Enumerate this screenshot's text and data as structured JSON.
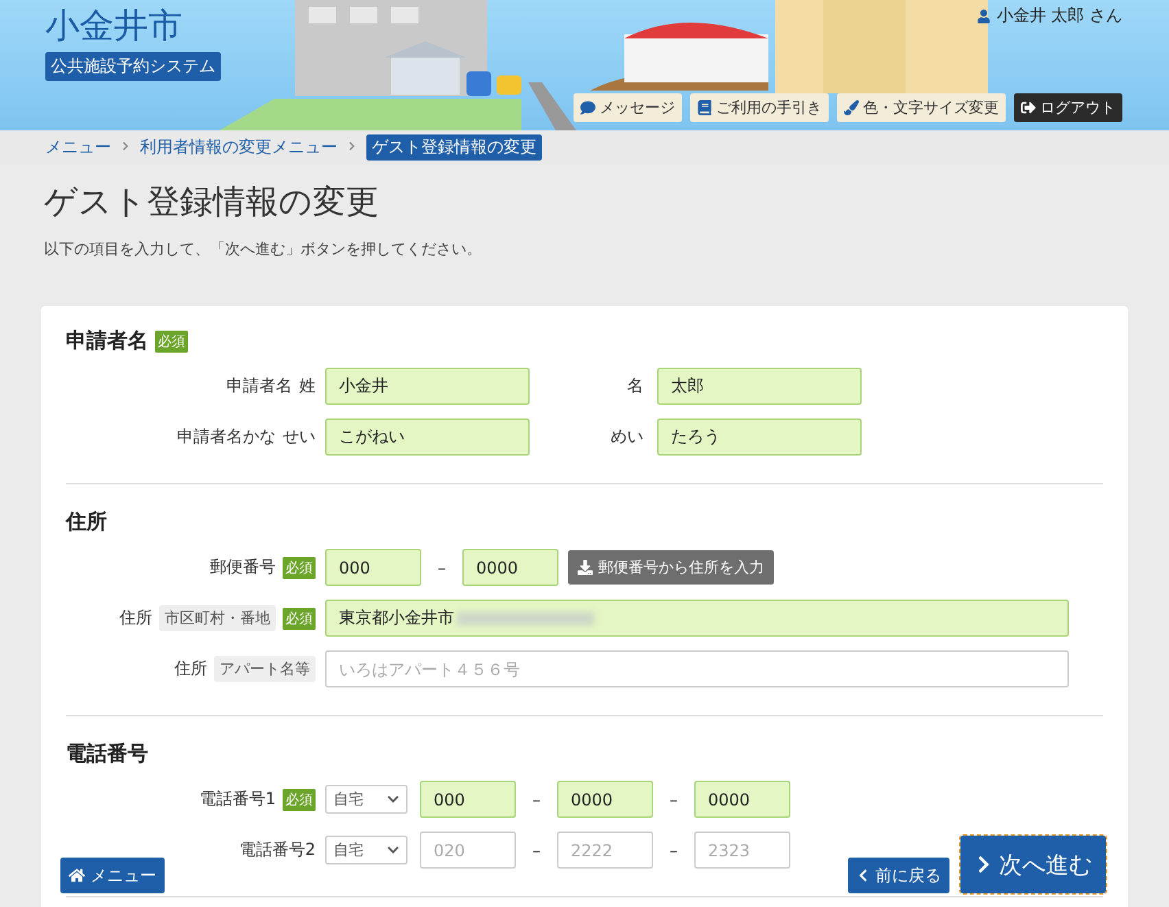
{
  "header": {
    "city": "小金井市",
    "system": "公共施設予約システム",
    "user": "小金井 太郎 さん",
    "actions": [
      {
        "label": "メッセージ",
        "kind": "message"
      },
      {
        "label": "ご利用の手引き",
        "kind": "guide"
      },
      {
        "label": "色・文字サイズ変更",
        "kind": "color"
      },
      {
        "label": "ログアウト",
        "kind": "logout"
      }
    ]
  },
  "breadcrumb": [
    {
      "label": "メニュー",
      "current": false
    },
    {
      "label": "利用者情報の変更メニュー",
      "current": false
    },
    {
      "label": "ゲスト登録情報の変更",
      "current": true
    }
  ],
  "title": "ゲスト登録情報の変更",
  "description": "以下の項目を入力して、「次へ進む」ボタンを押してください。",
  "sections": [
    {
      "heading": "申請者名",
      "badge": "必須",
      "rows": [
        {
          "kind": "pair",
          "label": "申請者名",
          "sublabel": "姓",
          "value": "小金井",
          "label2": "名",
          "value2": "太郎"
        },
        {
          "kind": "pair",
          "label": "申請者名かな",
          "sublabel": "せい",
          "value": "こがねい",
          "label2": "めい",
          "value2": "たろう"
        }
      ]
    },
    {
      "heading": "住所",
      "rows": [
        {
          "kind": "postal",
          "label": "郵便番号",
          "badge": "必須",
          "parts": [
            "000",
            "0000"
          ],
          "separator": "–",
          "button": "郵便番号から住所を入力"
        },
        {
          "kind": "text",
          "label": "住所",
          "tag": "市区町村・番地",
          "badge": "必須",
          "value": "東京都小金井市",
          "blurred": true
        },
        {
          "kind": "text",
          "label": "住所",
          "tag": "アパート名等",
          "placeholder": "いろはアパート４５６号"
        }
      ]
    },
    {
      "heading": "電話番号",
      "rows": [
        {
          "kind": "phone",
          "label": "電話番号1",
          "badge": "必須",
          "type": "自宅",
          "parts": [
            "000",
            "0000",
            "0000"
          ],
          "separator": "–"
        },
        {
          "kind": "phone",
          "label": "電話番号2",
          "type": "自宅",
          "placeholders": [
            "020",
            "2222",
            "2323"
          ],
          "separator": "–"
        }
      ]
    }
  ],
  "footer": {
    "menu": "メニュー",
    "back": "前に戻る",
    "next": "次へ進む"
  }
}
